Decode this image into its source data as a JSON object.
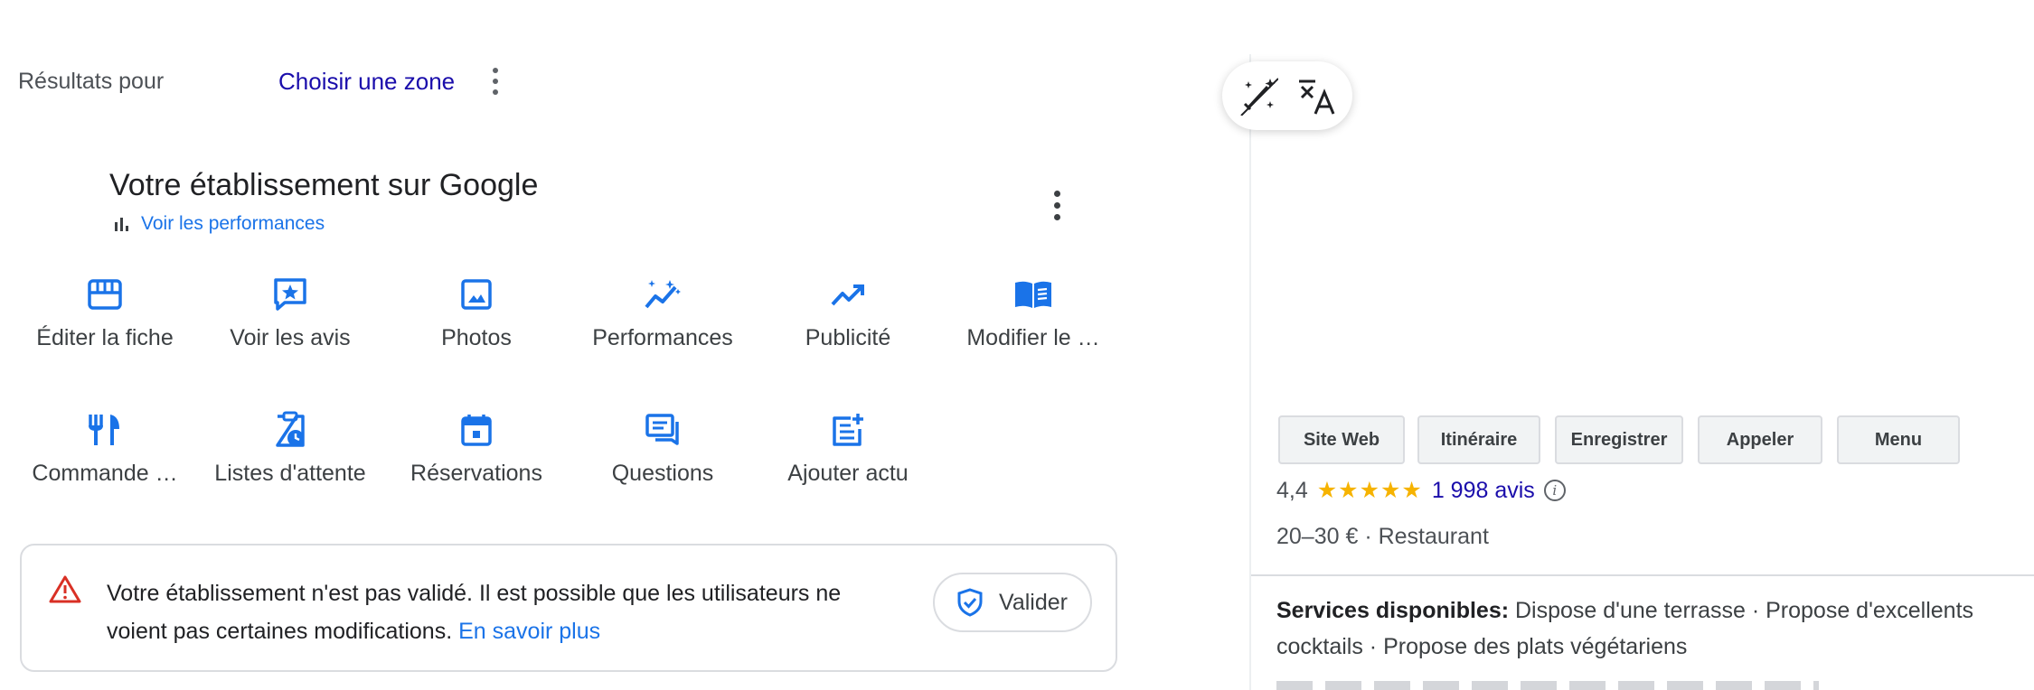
{
  "results": {
    "label": "Résultats pour",
    "zone_link": "Choisir une zone"
  },
  "business": {
    "title": "Votre établissement sur Google",
    "performance_link": "Voir les performances"
  },
  "actions": [
    {
      "label": "Éditer la fiche",
      "icon": "storefront-icon"
    },
    {
      "label": "Voir les avis",
      "icon": "review-star-icon"
    },
    {
      "label": "Photos",
      "icon": "photo-icon"
    },
    {
      "label": "Performances",
      "icon": "sparkle-trend-icon"
    },
    {
      "label": "Publicité",
      "icon": "trending-up-icon"
    },
    {
      "label": "Modifier le …",
      "icon": "menu-book-icon"
    },
    {
      "label": "Commande …",
      "icon": "fork-knife-icon"
    },
    {
      "label": "Listes d'attente",
      "icon": "waitlist-clipboard-icon"
    },
    {
      "label": "Réservations",
      "icon": "calendar-icon"
    },
    {
      "label": "Questions",
      "icon": "chat-questions-icon"
    },
    {
      "label": "Ajouter actu",
      "icon": "post-add-icon"
    }
  ],
  "warning": {
    "text": "Votre établissement n'est pas validé. Il est possible que les utilisateurs ne voient pas certaines modifications.",
    "learn_more": "En savoir plus",
    "validate_label": "Valider"
  },
  "place": {
    "buttons": [
      "Site Web",
      "Itinéraire",
      "Enregistrer",
      "Appeler",
      "Menu"
    ],
    "rating": "4,4",
    "stars": "★★★★★",
    "review_count": "1 998 avis",
    "price": "20–30 €",
    "price_sep": " · ",
    "category": "Restaurant",
    "services_label": "Services disponibles:",
    "services_text": "Dispose d'une terrasse · Propose d'excellents cocktails · Propose des plats végétariens"
  },
  "colors": {
    "accent": "#1a73e8",
    "link": "#1a0dab",
    "warning": "#d93025",
    "star": "#f6b300"
  }
}
